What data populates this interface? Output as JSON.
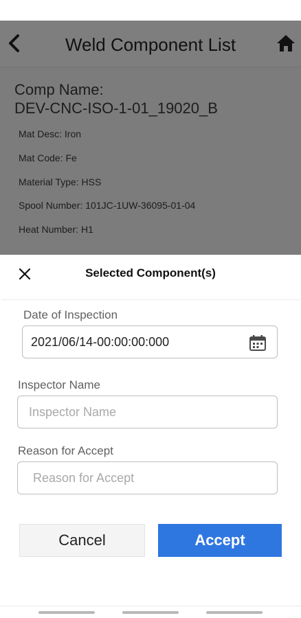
{
  "app_header": {
    "title": "Weld Component List"
  },
  "component": {
    "name_label": "Comp Name:",
    "name_value": "DEV-CNC-ISO-1-01_19020_B",
    "details": [
      "Mat Desc: Iron",
      "Mat Code: Fe",
      "Material Type: HSS",
      "Spool Number: 101JC-1UW-36095-01-04",
      "Heat Number: H1"
    ]
  },
  "dialog": {
    "title": "Selected Component(s)",
    "date_label": "Date of Inspection",
    "date_value": "2021/06/14-00:00:00:000",
    "inspector_label": "Inspector Name",
    "inspector_placeholder": "Inspector Name",
    "inspector_value": "",
    "reason_label": "Reason for Accept",
    "reason_placeholder": "Reason for Accept",
    "reason_value": "",
    "cancel_label": "Cancel",
    "accept_label": "Accept"
  },
  "icons": {
    "back": "chevron-left-icon",
    "home": "home-icon",
    "close": "close-icon",
    "calendar": "calendar-icon"
  },
  "colors": {
    "accent": "#2f77e0",
    "overlay": "#000000"
  }
}
